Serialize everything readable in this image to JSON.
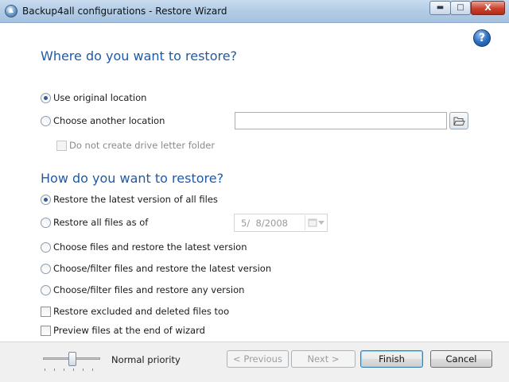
{
  "window": {
    "title": "Backup4all configurations - Restore Wizard",
    "controls": {
      "minimize": "▬",
      "maximize": "□",
      "close": "X"
    }
  },
  "help": {
    "glyph": "?"
  },
  "location_section": {
    "heading": "Where do you want to restore?",
    "use_original": {
      "label": "Use original location",
      "checked": true
    },
    "choose_another": {
      "label": "Choose another location",
      "checked": false,
      "path_value": ""
    },
    "no_drive_letter": {
      "label": "Do not create drive letter folder",
      "checked": false,
      "enabled": false
    }
  },
  "method_section": {
    "heading": "How do you want to restore?",
    "latest_all": {
      "label": "Restore the latest version of all files",
      "checked": true
    },
    "all_as_of": {
      "label": "Restore all files as of",
      "checked": false,
      "date": "5/  8/2008"
    },
    "choose_latest": {
      "label": "Choose files and restore the latest version",
      "checked": false
    },
    "filter_latest": {
      "label": "Choose/filter files and restore the latest version",
      "checked": false
    },
    "filter_any": {
      "label": "Choose/filter files and restore any version",
      "checked": false
    },
    "excluded_deleted": {
      "label": "Restore excluded and deleted files too",
      "checked": false
    },
    "preview": {
      "label": "Preview files at the end of wizard",
      "checked": false
    }
  },
  "footer": {
    "priority_label": "Normal priority",
    "priority_level": 0.5,
    "previous": "< Previous",
    "next": "Next >",
    "finish": "Finish",
    "cancel": "Cancel"
  }
}
